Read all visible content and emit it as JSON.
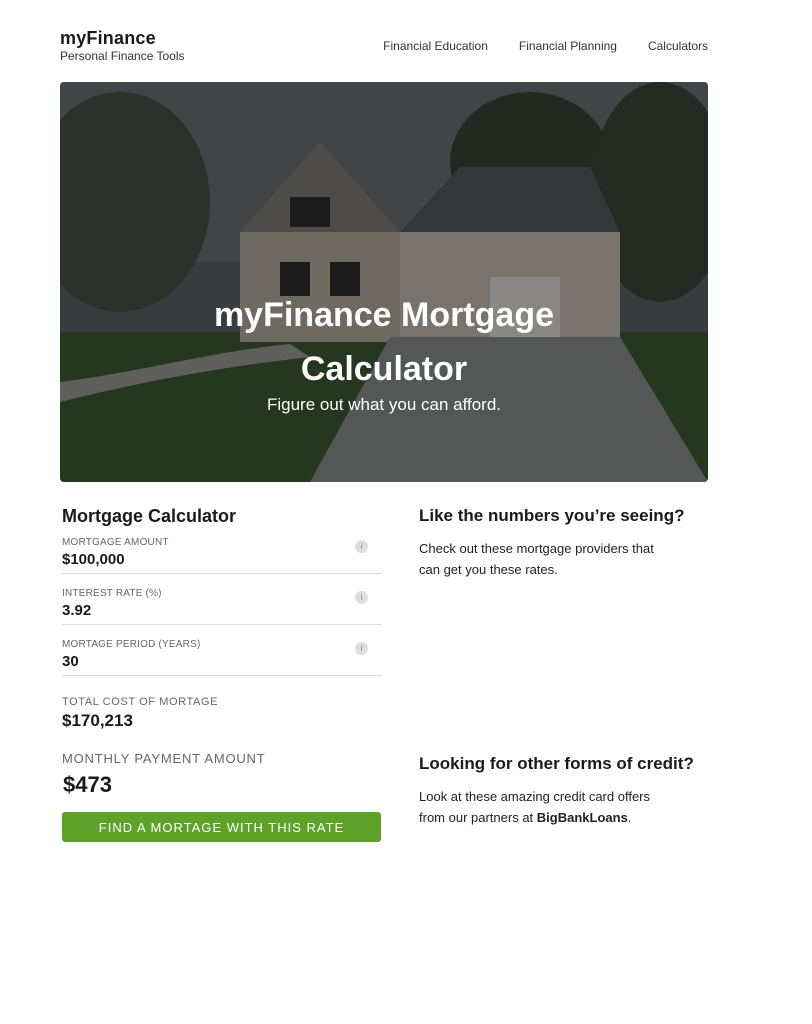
{
  "brand": {
    "name": "myFinance",
    "tagline": "Personal Finance Tools"
  },
  "nav": [
    "Financial Education",
    "Financial Planning",
    "Calculators"
  ],
  "hero": {
    "title": "myFinance Mortgage Calculator",
    "subtitle": "Figure out what you can afford."
  },
  "calculator": {
    "title": "Mortgage Calculator",
    "fields": [
      {
        "label": "Mortgage Amount",
        "value": "$100,000"
      },
      {
        "label": "Interest Rate (%)",
        "value": "3.92"
      },
      {
        "label": "Mortage Period (Years)",
        "value": "30"
      }
    ],
    "info_glyph": "i",
    "total_label": "Total Cost of Mortage",
    "total_value": "$170,213",
    "monthly_label": "Monthly Payment Amount",
    "monthly_value": "$473",
    "cta_label": "Find a Mortage With This Rate",
    "cta_color": "#5fa22a"
  },
  "side": {
    "providers_title": "Like the numbers you’re seeing?",
    "providers_text": "Check out these mortgage providers that can get you these rates.",
    "credit_title": "Looking for other forms of credit?",
    "credit_text_prefix": "Look at these amazing credit card offers from our partners at ",
    "credit_partner": "BigBankLoans",
    "credit_text_suffix": "."
  }
}
